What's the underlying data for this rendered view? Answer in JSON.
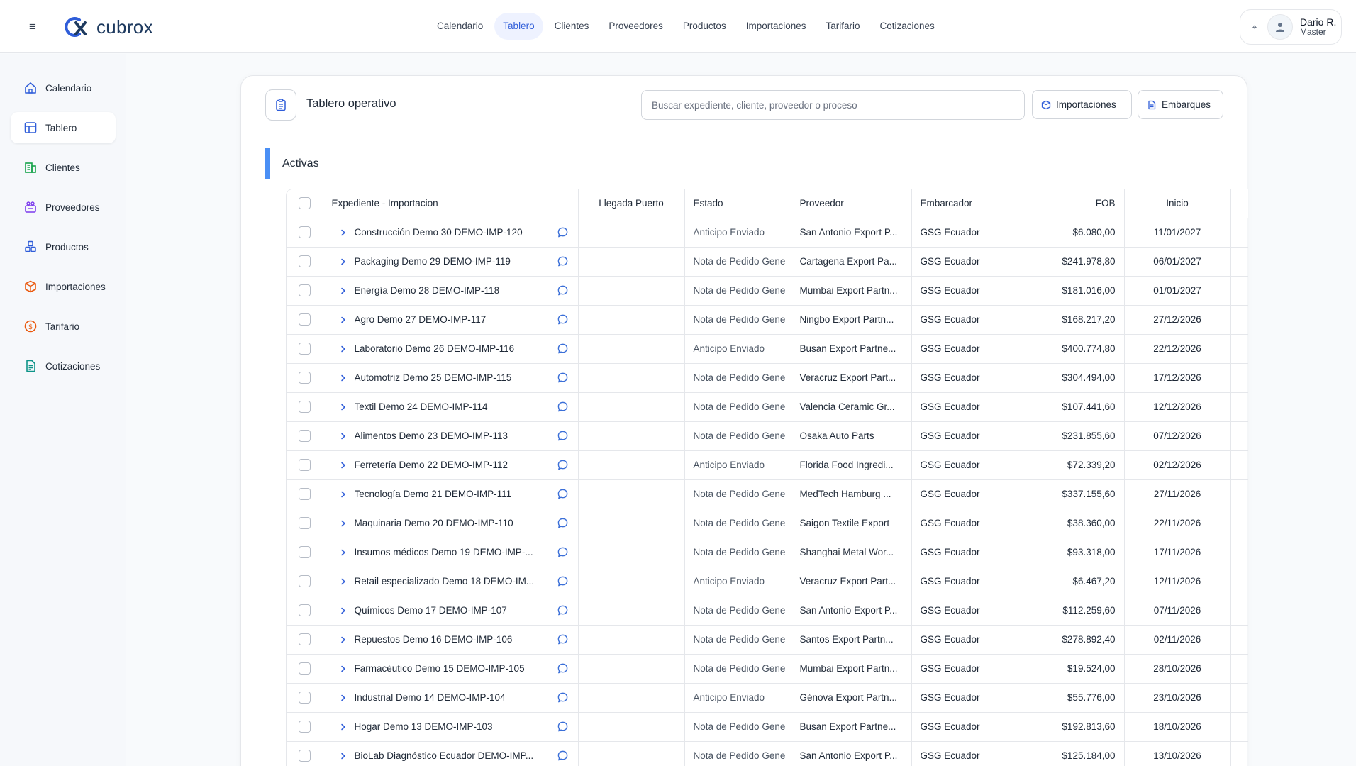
{
  "app": {
    "brand": "cubrox",
    "hamburger_glyph": "≡",
    "user": {
      "name": "Dario R.",
      "role": "Master"
    }
  },
  "topnav": [
    {
      "label": "Calendario"
    },
    {
      "label": "Tablero",
      "active": true
    },
    {
      "label": "Clientes"
    },
    {
      "label": "Proveedores"
    },
    {
      "label": "Productos"
    },
    {
      "label": "Importaciones"
    },
    {
      "label": "Tarifario"
    },
    {
      "label": "Cotizaciones"
    }
  ],
  "sidebar": {
    "items": [
      {
        "label": "Calendario",
        "icon": "home-icon",
        "color": "#2f5dd9"
      },
      {
        "label": "Tablero",
        "icon": "table-grid-icon",
        "color": "#2f5dd9",
        "active": true
      },
      {
        "label": "Clientes",
        "icon": "building-icon",
        "color": "#16a34a"
      },
      {
        "label": "Proveedores",
        "icon": "supplier-icon",
        "color": "#7c3aed"
      },
      {
        "label": "Productos",
        "icon": "cubes-icon",
        "color": "#2f5dd9"
      },
      {
        "label": "Importaciones",
        "icon": "box-icon",
        "color": "#ea580c"
      },
      {
        "label": "Tarifario",
        "icon": "dollar-coin-icon",
        "color": "#ea580c"
      },
      {
        "label": "Cotizaciones",
        "icon": "document-icon",
        "color": "#0d9488"
      }
    ]
  },
  "panel": {
    "title": "Tablero operativo",
    "search_placeholder": "Buscar expediente, cliente, proveedor o proceso",
    "btn_importaciones": "Importaciones",
    "btn_embarques": "Embarques",
    "section_title": "Activas"
  },
  "table": {
    "columns": {
      "expediente": "Expediente - Importacion",
      "llegada": "Llegada Puerto",
      "estado": "Estado",
      "proveedor": "Proveedor",
      "embarcador": "Embarcador",
      "fob": "FOB",
      "inicio": "Inicio"
    },
    "rows": [
      {
        "expediente": "Construcción Demo 30 DEMO-IMP-120",
        "llegada": "",
        "estado": "Anticipo Enviado",
        "proveedor": "San Antonio Export P...",
        "embarcador": "GSG Ecuador",
        "fob": "$6.080,00",
        "inicio": "11/01/2027"
      },
      {
        "expediente": "Packaging Demo 29 DEMO-IMP-119",
        "llegada": "",
        "estado": "Nota de Pedido Gene",
        "proveedor": "Cartagena Export Pa...",
        "embarcador": "GSG Ecuador",
        "fob": "$241.978,80",
        "inicio": "06/01/2027"
      },
      {
        "expediente": "Energía Demo 28 DEMO-IMP-118",
        "llegada": "",
        "estado": "Nota de Pedido Gene",
        "proveedor": "Mumbai Export Partn...",
        "embarcador": "GSG Ecuador",
        "fob": "$181.016,00",
        "inicio": "01/01/2027"
      },
      {
        "expediente": "Agro Demo 27 DEMO-IMP-117",
        "llegada": "",
        "estado": "Nota de Pedido Gene",
        "proveedor": "Ningbo Export Partn...",
        "embarcador": "GSG Ecuador",
        "fob": "$168.217,20",
        "inicio": "27/12/2026"
      },
      {
        "expediente": "Laboratorio Demo 26 DEMO-IMP-116",
        "llegada": "",
        "estado": "Anticipo Enviado",
        "proveedor": "Busan Export Partne...",
        "embarcador": "GSG Ecuador",
        "fob": "$400.774,80",
        "inicio": "22/12/2026"
      },
      {
        "expediente": "Automotriz Demo 25 DEMO-IMP-115",
        "llegada": "",
        "estado": "Nota de Pedido Gene",
        "proveedor": "Veracruz Export Part...",
        "embarcador": "GSG Ecuador",
        "fob": "$304.494,00",
        "inicio": "17/12/2026"
      },
      {
        "expediente": "Textil Demo 24 DEMO-IMP-114",
        "llegada": "",
        "estado": "Nota de Pedido Gene",
        "proveedor": "Valencia Ceramic Gr...",
        "embarcador": "GSG Ecuador",
        "fob": "$107.441,60",
        "inicio": "12/12/2026"
      },
      {
        "expediente": "Alimentos Demo 23 DEMO-IMP-113",
        "llegada": "",
        "estado": "Nota de Pedido Gene",
        "proveedor": "Osaka Auto Parts",
        "embarcador": "GSG Ecuador",
        "fob": "$231.855,60",
        "inicio": "07/12/2026"
      },
      {
        "expediente": "Ferretería Demo 22 DEMO-IMP-112",
        "llegada": "",
        "estado": "Anticipo Enviado",
        "proveedor": "Florida Food Ingredi...",
        "embarcador": "GSG Ecuador",
        "fob": "$72.339,20",
        "inicio": "02/12/2026"
      },
      {
        "expediente": "Tecnología Demo 21 DEMO-IMP-111",
        "llegada": "",
        "estado": "Nota de Pedido Gene",
        "proveedor": "MedTech Hamburg ...",
        "embarcador": "GSG Ecuador",
        "fob": "$337.155,60",
        "inicio": "27/11/2026"
      },
      {
        "expediente": "Maquinaria Demo 20 DEMO-IMP-110",
        "llegada": "",
        "estado": "Nota de Pedido Gene",
        "proveedor": "Saigon Textile Export",
        "embarcador": "GSG Ecuador",
        "fob": "$38.360,00",
        "inicio": "22/11/2026"
      },
      {
        "expediente": "Insumos médicos Demo 19 DEMO-IMP-...",
        "llegada": "",
        "estado": "Nota de Pedido Gene",
        "proveedor": "Shanghai Metal Wor...",
        "embarcador": "GSG Ecuador",
        "fob": "$93.318,00",
        "inicio": "17/11/2026"
      },
      {
        "expediente": "Retail especializado Demo 18 DEMO-IM...",
        "llegada": "",
        "estado": "Anticipo Enviado",
        "proveedor": "Veracruz Export Part...",
        "embarcador": "GSG Ecuador",
        "fob": "$6.467,20",
        "inicio": "12/11/2026"
      },
      {
        "expediente": "Químicos Demo 17 DEMO-IMP-107",
        "llegada": "",
        "estado": "Nota de Pedido Gene",
        "proveedor": "San Antonio Export P...",
        "embarcador": "GSG Ecuador",
        "fob": "$112.259,60",
        "inicio": "07/11/2026"
      },
      {
        "expediente": "Repuestos Demo 16 DEMO-IMP-106",
        "llegada": "",
        "estado": "Nota de Pedido Gene",
        "proveedor": "Santos Export Partn...",
        "embarcador": "GSG Ecuador",
        "fob": "$278.892,40",
        "inicio": "02/11/2026"
      },
      {
        "expediente": "Farmacéutico Demo 15 DEMO-IMP-105",
        "llegada": "",
        "estado": "Nota de Pedido Gene",
        "proveedor": "Mumbai Export Partn...",
        "embarcador": "GSG Ecuador",
        "fob": "$19.524,00",
        "inicio": "28/10/2026"
      },
      {
        "expediente": "Industrial Demo 14 DEMO-IMP-104",
        "llegada": "",
        "estado": "Anticipo Enviado",
        "proveedor": "Génova Export Partn...",
        "embarcador": "GSG Ecuador",
        "fob": "$55.776,00",
        "inicio": "23/10/2026"
      },
      {
        "expediente": "Hogar Demo 13 DEMO-IMP-103",
        "llegada": "",
        "estado": "Nota de Pedido Gene",
        "proveedor": "Busan Export Partne...",
        "embarcador": "GSG Ecuador",
        "fob": "$192.813,60",
        "inicio": "18/10/2026"
      },
      {
        "expediente": "BioLab Diagnóstico Ecuador DEMO-IMP...",
        "llegada": "",
        "estado": "Nota de Pedido Gene",
        "proveedor": "San Antonio Export P...",
        "embarcador": "GSG Ecuador",
        "fob": "$125.184,00",
        "inicio": "13/10/2026"
      }
    ]
  },
  "colors": {
    "accent": "#2f5dd9",
    "section_accent": "#4a8ff5",
    "chat_icon": "#3b6fd8"
  }
}
